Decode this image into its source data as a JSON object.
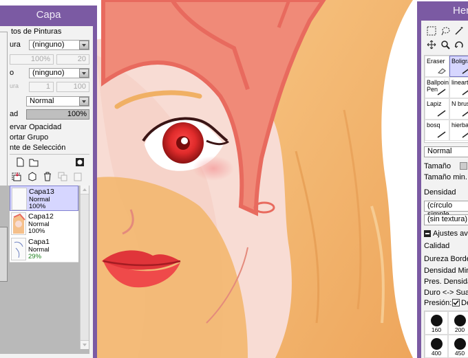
{
  "layer_panel": {
    "title": "Capa",
    "paper_effects_label": "tos de Pinturas",
    "texture_label": "ura",
    "texture_value": "(ninguno)",
    "texture_strength_value": "100%",
    "texture_scale_value": "20",
    "effect_label": "o",
    "effect_value": "(ninguno)",
    "effect_width_label": "ura",
    "effect_width_value": "1",
    "effect_strength_value": "100",
    "blend_mode_value": "Normal",
    "opacity_label": "ad",
    "opacity_value": "100%",
    "preserve_opacity_label": "ervar Opacidad",
    "clip_group_label": "ortar Grupo",
    "selection_source_label": "nte de Selección",
    "layers": [
      {
        "name": "Capa13",
        "mode": "Normal",
        "opacity": "100%"
      },
      {
        "name": "Capa12",
        "mode": "Normal",
        "opacity": "100%"
      },
      {
        "name": "Capa1",
        "mode": "Normal",
        "opacity": "29%"
      }
    ]
  },
  "tools_panel": {
    "title": "Her",
    "brushes": [
      {
        "label": "Eraser"
      },
      {
        "label": "Boligra"
      },
      {
        "label": "Ballpoint Pen"
      },
      {
        "label": "lineart"
      },
      {
        "label": "Lapiz"
      },
      {
        "label": "N brus"
      },
      {
        "label": "bosq"
      },
      {
        "label": "hierba"
      }
    ],
    "blend_value": "Normal",
    "size_label": "Tamaño",
    "min_size_label": "Tamaño min.",
    "density_label": "Densidad",
    "shape_value": "(círculo simple",
    "texture_value": "(sin textura)",
    "advanced_label": "Ajustes ava",
    "quality_label": "Calidad",
    "edge_hardness_label": "Dureza Borde",
    "min_density_label": "Densidad Min.",
    "max_density_pressure_label": "Pres. Densidad",
    "hard_soft_label": "Duro <-> Suav",
    "pressure_label": "Presión:",
    "pressure_check_label": "De",
    "size_presets": [
      "160",
      "200",
      "400",
      "450"
    ]
  },
  "colors": {
    "panel_purple": "#7b5aa3",
    "selected_row": "#d6d6ff",
    "hair": "#f0b064",
    "skin": "#f8dcd4",
    "outline": "#e86a5e"
  }
}
